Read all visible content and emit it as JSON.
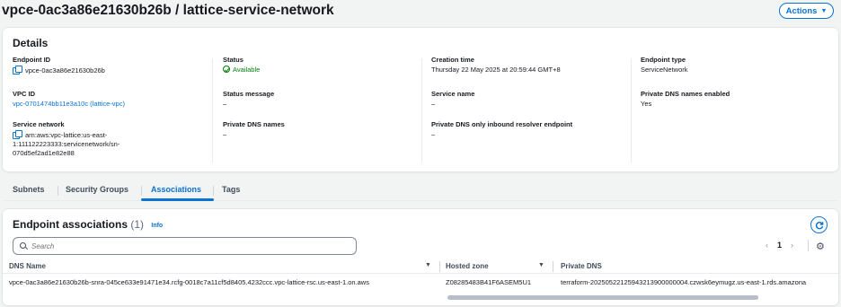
{
  "header": {
    "title": "vpce-0ac3a86e21630b26b / lattice-service-network",
    "actions_label": "Actions"
  },
  "details": {
    "title": "Details",
    "endpoint_id": {
      "label": "Endpoint ID",
      "value": "vpce-0ac3a86e21630b26b"
    },
    "vpc_id": {
      "label": "VPC ID",
      "value": "vpc-0701474bb11e3a10c (lattice-vpc)"
    },
    "service_network": {
      "label": "Service network",
      "value": "arn:aws:vpc-lattice:us-east-1:111122223333:servicenetwork/sn-070d5ef2ad1e82e88",
      "line1": "arn:aws:vpc-lattice:us-east-",
      "line2": "1:111122223333:servicenetwork/sn-",
      "line3": "070d5ef2ad1e82e88"
    },
    "status": {
      "label": "Status",
      "value": "Available"
    },
    "status_message": {
      "label": "Status message",
      "value": "–"
    },
    "private_dns_names": {
      "label": "Private DNS names",
      "value": "–"
    },
    "creation_time": {
      "label": "Creation time",
      "value": "Thursday 22 May 2025 at 20:59:44 GMT+8"
    },
    "service_name": {
      "label": "Service name",
      "value": "–"
    },
    "private_dns_inbound": {
      "label": "Private DNS only inbound resolver endpoint",
      "value": "–"
    },
    "endpoint_type": {
      "label": "Endpoint type",
      "value": "ServiceNetwork"
    },
    "private_dns_enabled": {
      "label": "Private DNS names enabled",
      "value": "Yes"
    }
  },
  "tabs": [
    {
      "label": "Subnets"
    },
    {
      "label": "Security Groups"
    },
    {
      "label": "Associations",
      "active": true
    },
    {
      "label": "Tags"
    }
  ],
  "associations": {
    "title": "Endpoint associations",
    "count": "(1)",
    "info_label": "Info",
    "search_placeholder": "Search",
    "pager": {
      "prev": "‹",
      "page": "1",
      "next": "›"
    },
    "columns": [
      "DNS Name",
      "Hosted zone",
      "Private DNS"
    ],
    "rows": [
      {
        "dns_name": "vpce-0ac3a86e21630b26b-snra-045ce633e91471e34.rcfg-0018c7a11cf5d8405.4232ccc.vpc-lattice-rsc.us-east-1.on.aws",
        "hosted_zone": "Z08285483B41F6ASEM5U1",
        "private_dns": "terraform-20250522125943213900000004.czwsk6eymugz.us-east-1.rds.amazona"
      }
    ]
  },
  "colors": {
    "accent": "#0972d3",
    "success": "#037f0c",
    "text": "#16191f",
    "background": "#f2f3f3"
  },
  "icons": [
    "copy-icon",
    "status-success-icon",
    "refresh-icon",
    "search-icon",
    "settings-icon",
    "sort-caret-icon",
    "caret-down-icon"
  ]
}
